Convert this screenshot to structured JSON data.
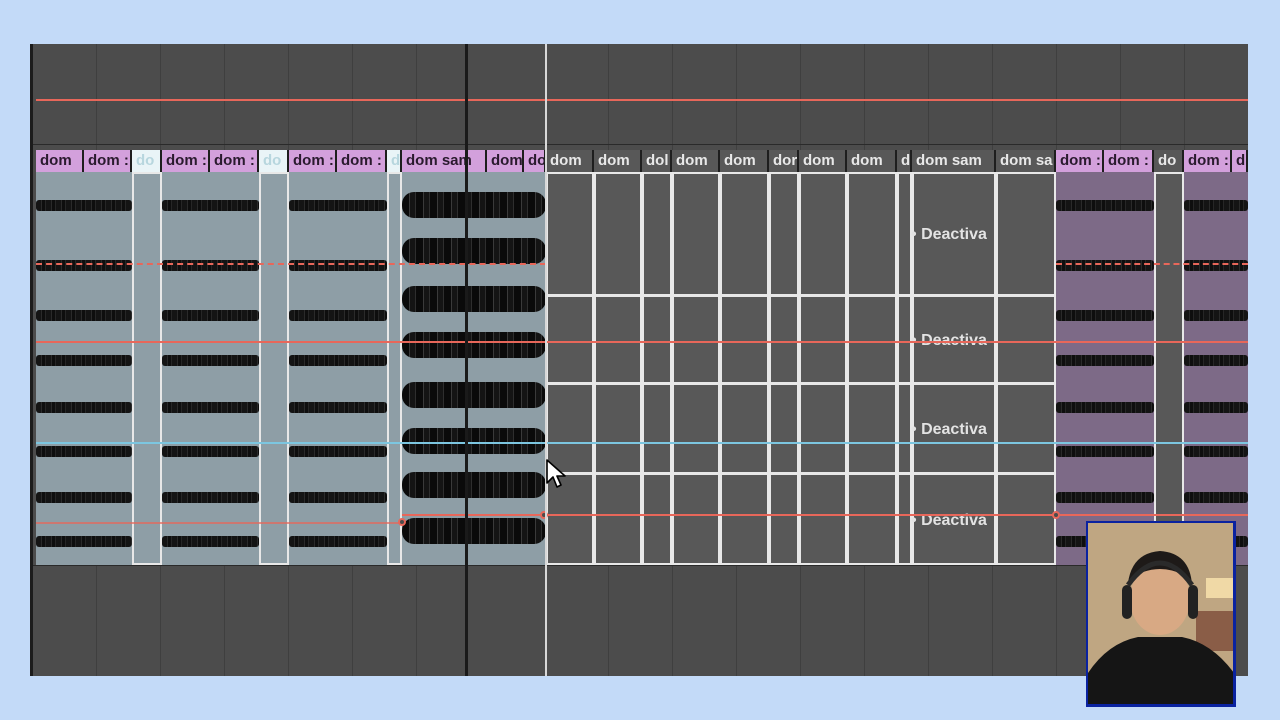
{
  "colors": {
    "background": "#c3daf8",
    "track_dark": "#4c4c4c",
    "clip_pink_header": "#d3a0dc",
    "clip_pink_body": "#8e9ea6",
    "clip_purple_body": "#7d6a87",
    "clip_inactive": "#5b5b5b",
    "envelope_red": "#e8675a",
    "envelope_blue": "#7cc6e0",
    "webcam_border": "#0a22a0"
  },
  "clips": {
    "dom": "dom",
    "dom_trunc": "dom :",
    "dom_sam": "dom sam",
    "dom_sa": "dom sa",
    "do": "do",
    "dor": "dor",
    "dol": "dol",
    "d": "d"
  },
  "deactivated_label": "Deactiva",
  "deactivated_prefix": "•",
  "webcam": {
    "label": "presenter webcam"
  },
  "cursor": {
    "icon": "arrow-cursor-icon"
  }
}
